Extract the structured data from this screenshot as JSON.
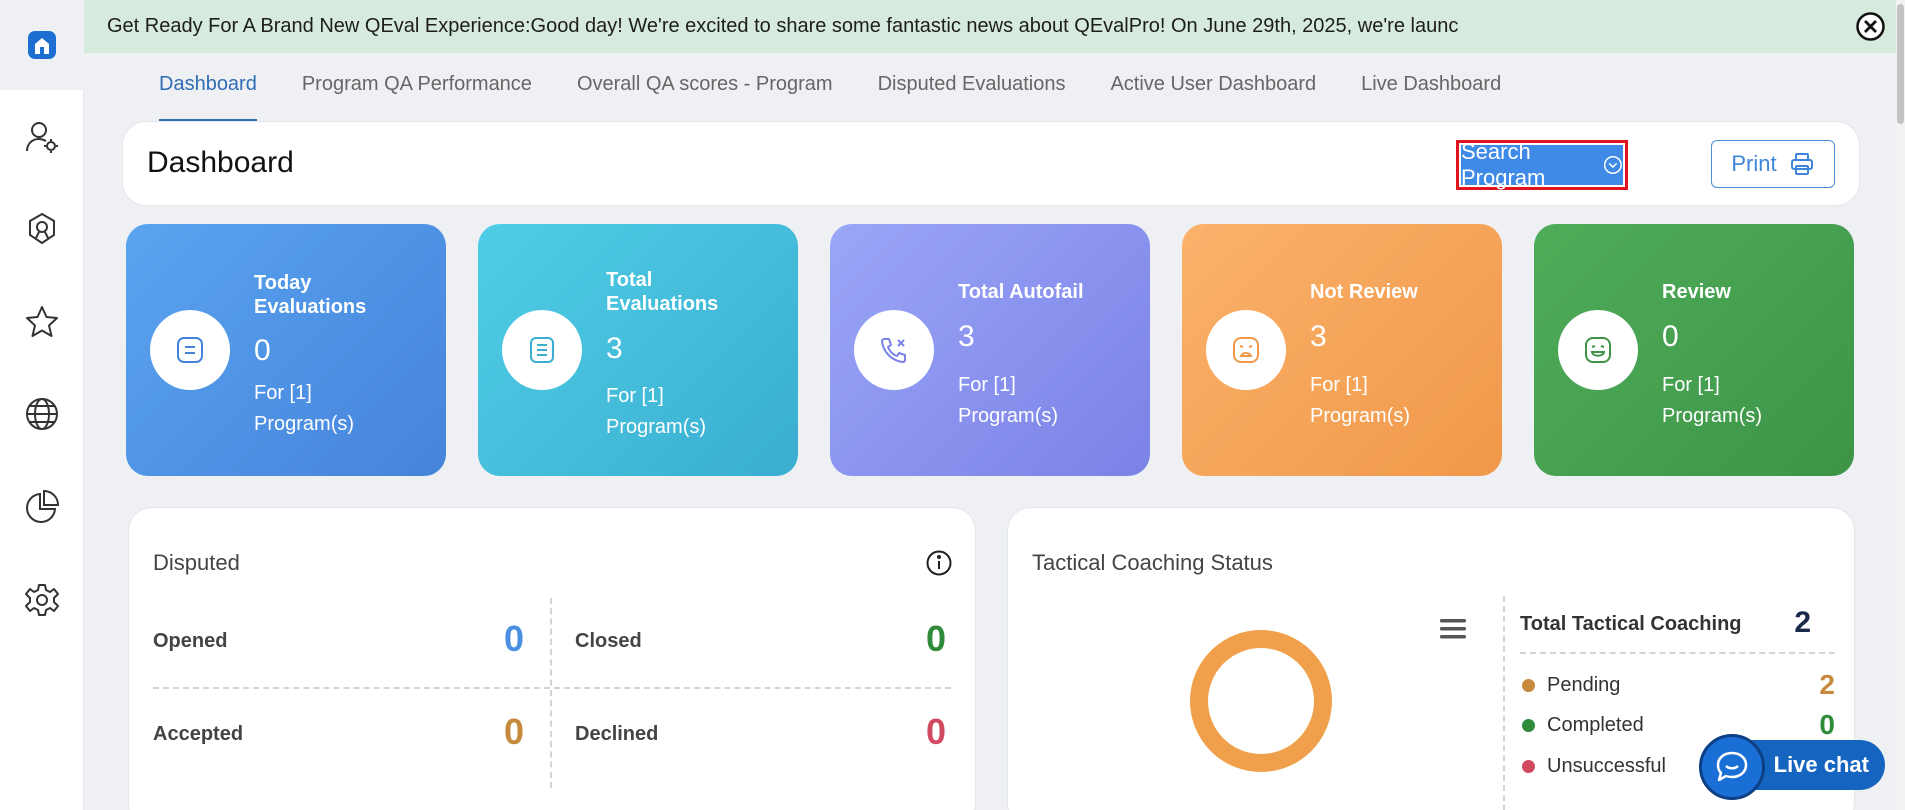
{
  "banner": {
    "text": "Get Ready For A Brand New QEval Experience:Good day! We're excited to share some fantastic news about QEvalPro! On June 29th, 2025, we're launc"
  },
  "sidebar": {
    "items": [
      {
        "icon": "home-icon"
      },
      {
        "icon": "user-settings-icon"
      },
      {
        "icon": "badge-icon"
      },
      {
        "icon": "star-icon"
      },
      {
        "icon": "globe-icon"
      },
      {
        "icon": "pie-chart-icon"
      },
      {
        "icon": "gear-icon"
      }
    ]
  },
  "tabs": [
    {
      "label": "Dashboard",
      "active": true
    },
    {
      "label": "Program QA Performance"
    },
    {
      "label": "Overall QA scores - Program"
    },
    {
      "label": "Disputed Evaluations"
    },
    {
      "label": "Active User Dashboard"
    },
    {
      "label": "Live Dashboard"
    }
  ],
  "header": {
    "title": "Dashboard",
    "search_label": "Search Program",
    "print_label": "Print"
  },
  "stats": [
    {
      "label": "Today Evaluations",
      "value": "0",
      "sub": "For [1] Program(s)",
      "icon": "list-icon"
    },
    {
      "label": "Total Evaluations",
      "value": "3",
      "sub": "For [1] Program(s)",
      "icon": "document-list-icon"
    },
    {
      "label": "Total Autofail",
      "value": "3",
      "sub": "For [1] Program(s)",
      "icon": "phone-cancel-icon"
    },
    {
      "label": "Not Review",
      "value": "3",
      "sub": "For [1] Program(s)",
      "icon": "sad-face-icon"
    },
    {
      "label": "Review",
      "value": "0",
      "sub": "For [1] Program(s)",
      "icon": "happy-face-icon"
    }
  ],
  "disputed": {
    "title": "Disputed",
    "opened_label": "Opened",
    "opened_value": "0",
    "closed_label": "Closed",
    "closed_value": "0",
    "accepted_label": "Accepted",
    "accepted_value": "0",
    "declined_label": "Declined",
    "declined_value": "0"
  },
  "tactical": {
    "title": "Tactical Coaching Status",
    "total_label": "Total Tactical Coaching",
    "total_value": "2",
    "rows": [
      {
        "name": "Pending",
        "value": "2",
        "color": "#c68a3c"
      },
      {
        "name": "Completed",
        "value": "0",
        "color": "#2e8b3a"
      },
      {
        "name": "Unsuccessful",
        "value": "",
        "color": "#d14a5f"
      }
    ]
  },
  "livechat": {
    "label": "Live chat"
  },
  "colors": {
    "accent": "#2f6db5",
    "blue_value": "#4a90e2",
    "green_value": "#2e8b3a",
    "orange_value": "#c68a3c",
    "red_value": "#d14a5f",
    "donut": "#f0a04a"
  }
}
